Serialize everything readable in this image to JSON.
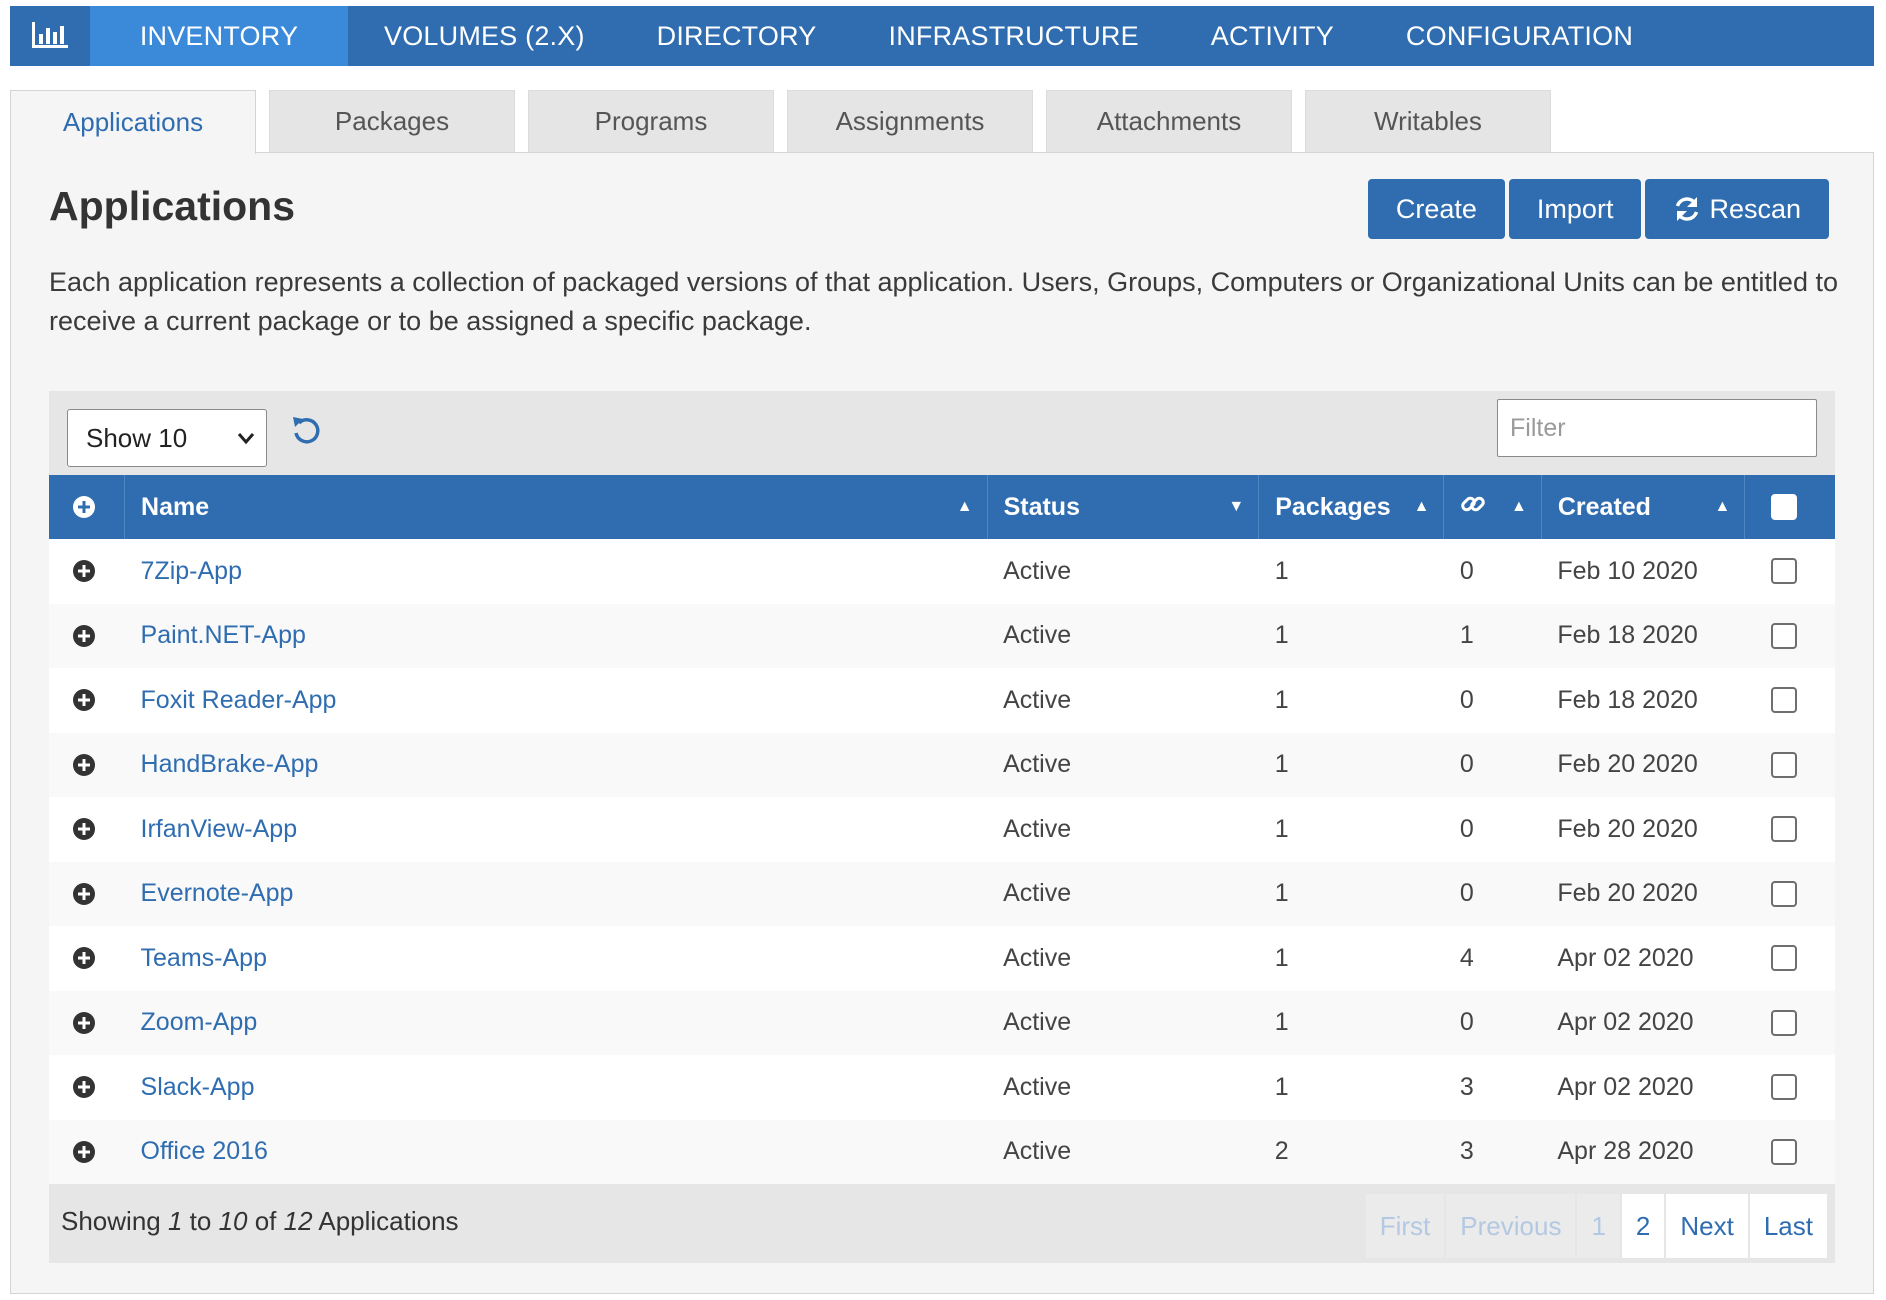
{
  "nav": {
    "items": [
      {
        "label": "INVENTORY",
        "active": true
      },
      {
        "label": "VOLUMES (2.X)"
      },
      {
        "label": "DIRECTORY"
      },
      {
        "label": "INFRASTRUCTURE"
      },
      {
        "label": "ACTIVITY"
      },
      {
        "label": "CONFIGURATION"
      }
    ],
    "logo_icon": "bar-chart-icon"
  },
  "tabs": [
    {
      "label": "Applications",
      "active": true
    },
    {
      "label": "Packages"
    },
    {
      "label": "Programs"
    },
    {
      "label": "Assignments"
    },
    {
      "label": "Attachments"
    },
    {
      "label": "Writables"
    }
  ],
  "page": {
    "title": "Applications",
    "description": "Each application represents a collection of packaged versions of that application. Users, Groups, Computers or Organizational Units can be entitled to receive a current package or to be assigned a specific package.",
    "buttons": {
      "create": "Create",
      "import": "Import",
      "rescan": "Rescan"
    }
  },
  "table_controls": {
    "page_size": "Show 10",
    "filter_placeholder": "Filter"
  },
  "table": {
    "columns": {
      "name": "Name",
      "status": "Status",
      "packages": "Packages",
      "attachments_icon": "link-icon",
      "created": "Created"
    },
    "rows": [
      {
        "name": "7Zip-App",
        "status": "Active",
        "packages": "1",
        "links": "0",
        "created": "Feb 10 2020"
      },
      {
        "name": "Paint.NET-App",
        "status": "Active",
        "packages": "1",
        "links": "1",
        "created": "Feb 18 2020"
      },
      {
        "name": "Foxit Reader-App",
        "status": "Active",
        "packages": "1",
        "links": "0",
        "created": "Feb 18 2020"
      },
      {
        "name": "HandBrake-App",
        "status": "Active",
        "packages": "1",
        "links": "0",
        "created": "Feb 20 2020"
      },
      {
        "name": "IrfanView-App",
        "status": "Active",
        "packages": "1",
        "links": "0",
        "created": "Feb 20 2020"
      },
      {
        "name": "Evernote-App",
        "status": "Active",
        "packages": "1",
        "links": "0",
        "created": "Feb 20 2020"
      },
      {
        "name": "Teams-App",
        "status": "Active",
        "packages": "1",
        "links": "4",
        "created": "Apr 02 2020"
      },
      {
        "name": "Zoom-App",
        "status": "Active",
        "packages": "1",
        "links": "0",
        "created": "Apr 02 2020"
      },
      {
        "name": "Slack-App",
        "status": "Active",
        "packages": "1",
        "links": "3",
        "created": "Apr 02 2020"
      },
      {
        "name": "Office 2016",
        "status": "Active",
        "packages": "2",
        "links": "3",
        "created": "Apr 28 2020"
      }
    ]
  },
  "footer": {
    "showing_prefix": "Showing ",
    "from": "1",
    "to_word": " to ",
    "to": "10",
    "of_word": " of ",
    "total": "12",
    "suffix": " Applications"
  },
  "pagination": {
    "first": "First",
    "previous": "Previous",
    "page1": "1",
    "page2": "2",
    "next": "Next",
    "last": "Last"
  },
  "colors": {
    "primary": "#2f6db0",
    "nav_active": "#3a8ad9",
    "panel_bg": "#f5f5f5"
  }
}
